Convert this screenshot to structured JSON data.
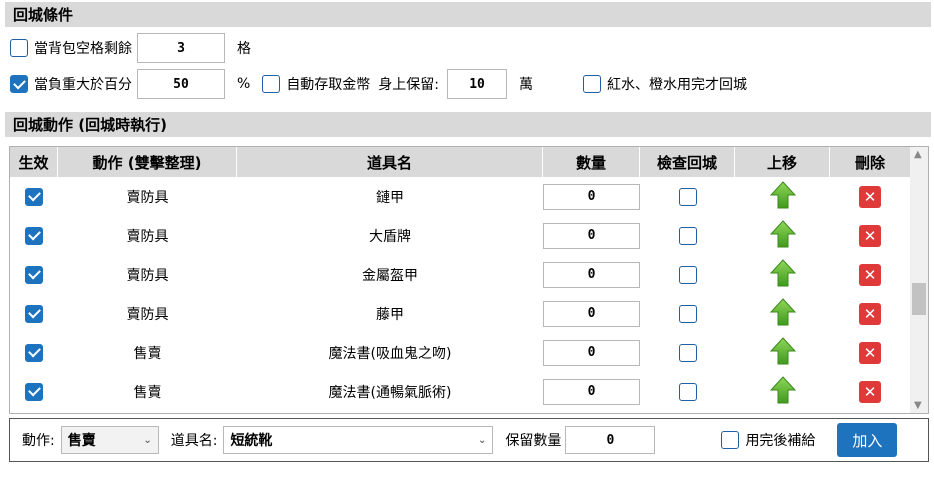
{
  "conditions": {
    "title": "回城條件",
    "bag_space": {
      "checked": false,
      "label": "當背包空格剩餘",
      "value": "3",
      "unit": "格"
    },
    "weight": {
      "checked": true,
      "label": "當負重大於百分",
      "value": "50",
      "unit": "%"
    },
    "auto_deposit": {
      "checked": false,
      "label": "自動存取金幣",
      "keep_label": "身上保留:",
      "value": "10",
      "unit": "萬"
    },
    "potion": {
      "checked": false,
      "label": "紅水、橙水用完才回城"
    }
  },
  "actions": {
    "title": "回城動作 (回城時執行)",
    "columns": [
      "生效",
      "動作 (雙擊整理)",
      "道具名",
      "數量",
      "檢查回城",
      "上移",
      "刪除"
    ],
    "rows": [
      {
        "enabled": true,
        "action": "賣防具",
        "item": "鏈甲",
        "qty": "0",
        "check": false
      },
      {
        "enabled": true,
        "action": "賣防具",
        "item": "大盾牌",
        "qty": "0",
        "check": false
      },
      {
        "enabled": true,
        "action": "賣防具",
        "item": "金屬盔甲",
        "qty": "0",
        "check": false
      },
      {
        "enabled": true,
        "action": "賣防具",
        "item": "藤甲",
        "qty": "0",
        "check": false
      },
      {
        "enabled": true,
        "action": "售賣",
        "item": "魔法書(吸血鬼之吻)",
        "qty": "0",
        "check": false
      },
      {
        "enabled": true,
        "action": "售賣",
        "item": "魔法書(通暢氣脈術)",
        "qty": "0",
        "check": false
      }
    ]
  },
  "bottom": {
    "action_label": "動作:",
    "action_value": "售賣",
    "item_label": "道具名:",
    "item_value": "短統靴",
    "keep_label": "保留數量",
    "keep_value": "0",
    "refill_label": "用完後補給",
    "refill_checked": false,
    "add_label": "加入"
  },
  "colors": {
    "accent": "#1e73be",
    "delete": "#e0393a",
    "arrow": "#5cb82e",
    "header_bg": "#d9d9d9"
  }
}
